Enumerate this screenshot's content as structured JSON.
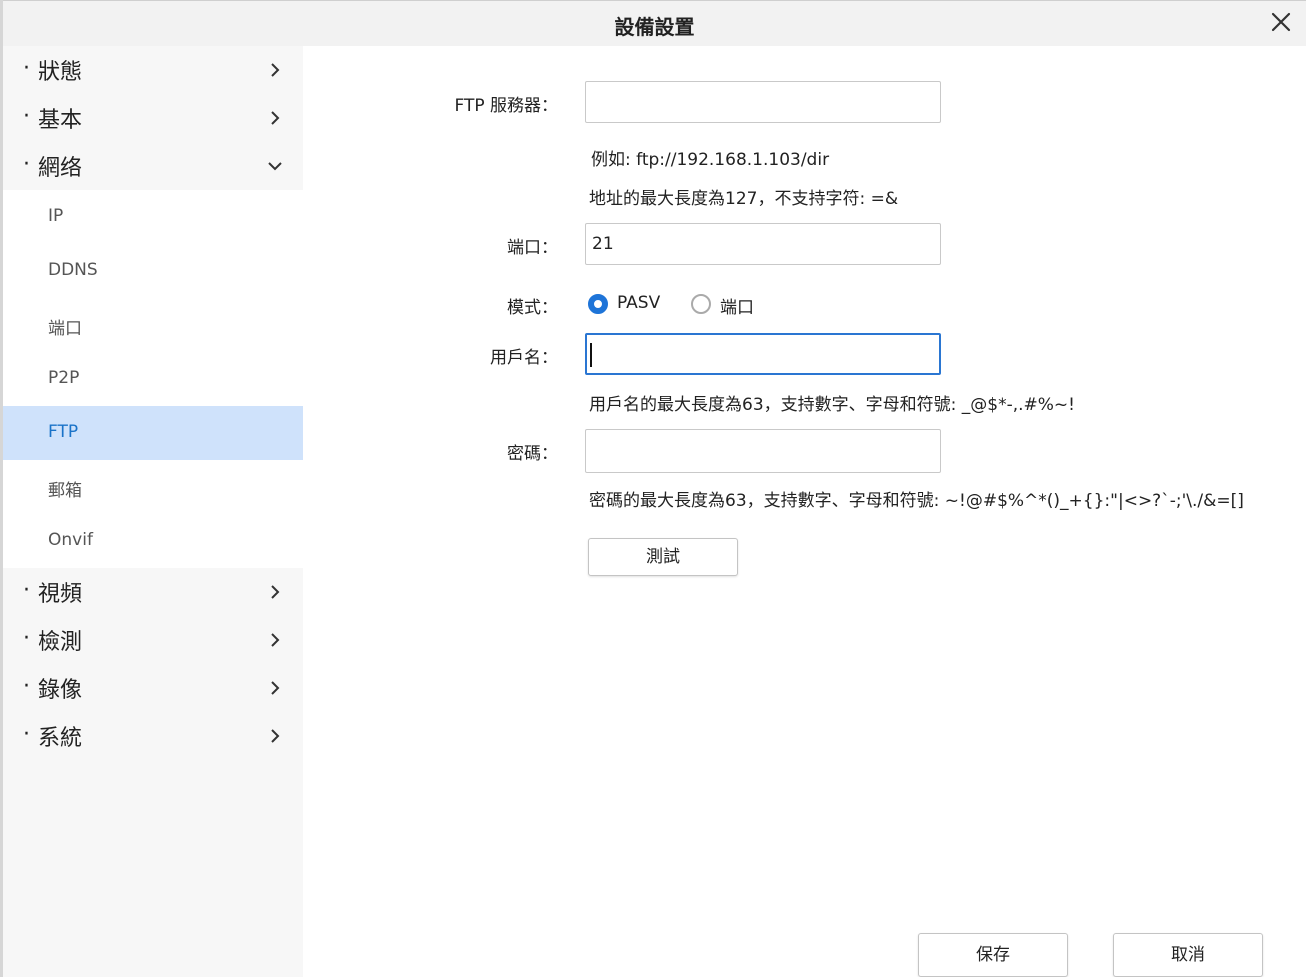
{
  "window": {
    "title": "設備設置"
  },
  "icons": {
    "close": "close-icon",
    "collapsed": "chevron-right-icon",
    "expanded": "chevron-down-icon",
    "radio": "radio-icon"
  },
  "sidebar": {
    "bullet": "·",
    "top_categories": [
      {
        "label": "狀態",
        "state": "collapsed"
      },
      {
        "label": "基本",
        "state": "collapsed"
      },
      {
        "label": "網络",
        "state": "expanded"
      }
    ],
    "network_items": [
      {
        "label": "IP"
      },
      {
        "label": "DDNS"
      },
      {
        "label": "端口"
      },
      {
        "label": "P2P"
      },
      {
        "label": "FTP",
        "selected": true
      },
      {
        "label": "郵箱"
      },
      {
        "label": "Onvif"
      }
    ],
    "bottom_categories": [
      {
        "label": "視頻",
        "state": "collapsed"
      },
      {
        "label": "檢測",
        "state": "collapsed"
      },
      {
        "label": "錄像",
        "state": "collapsed"
      },
      {
        "label": "系統",
        "state": "collapsed"
      }
    ]
  },
  "form": {
    "ftp_server": {
      "label": "FTP 服務器：",
      "value": "",
      "example": "例如: ftp://192.168.1.103/dir",
      "hint": "地址的最大長度為127，不支持字符: =&"
    },
    "port": {
      "label": "端口：",
      "value": "21"
    },
    "mode": {
      "label": "模式：",
      "options": [
        "PASV",
        "端口"
      ],
      "selected": "PASV"
    },
    "username": {
      "label": "用戶名：",
      "value": "",
      "hint": "用戶名的最大長度為63，支持數字、字母和符號: _@$*-,.#%~!"
    },
    "password": {
      "label": "密碼：",
      "value": "",
      "hint": "密碼的最大長度為63，支持數字、字母和符號: ~!@#$%^*()_+{}:\"|<>?`-;'\\./&=[]"
    },
    "test_button": "測試"
  },
  "footer": {
    "save_button": "保存",
    "cancel_button": "取消"
  },
  "colors": {
    "accent": "#1e74d8",
    "selected_bg": "#cfe2fb",
    "selected_text": "#1a73c8",
    "sidebar_bg": "#f7f7f7",
    "titlebar_bg": "#f2f2f2"
  }
}
